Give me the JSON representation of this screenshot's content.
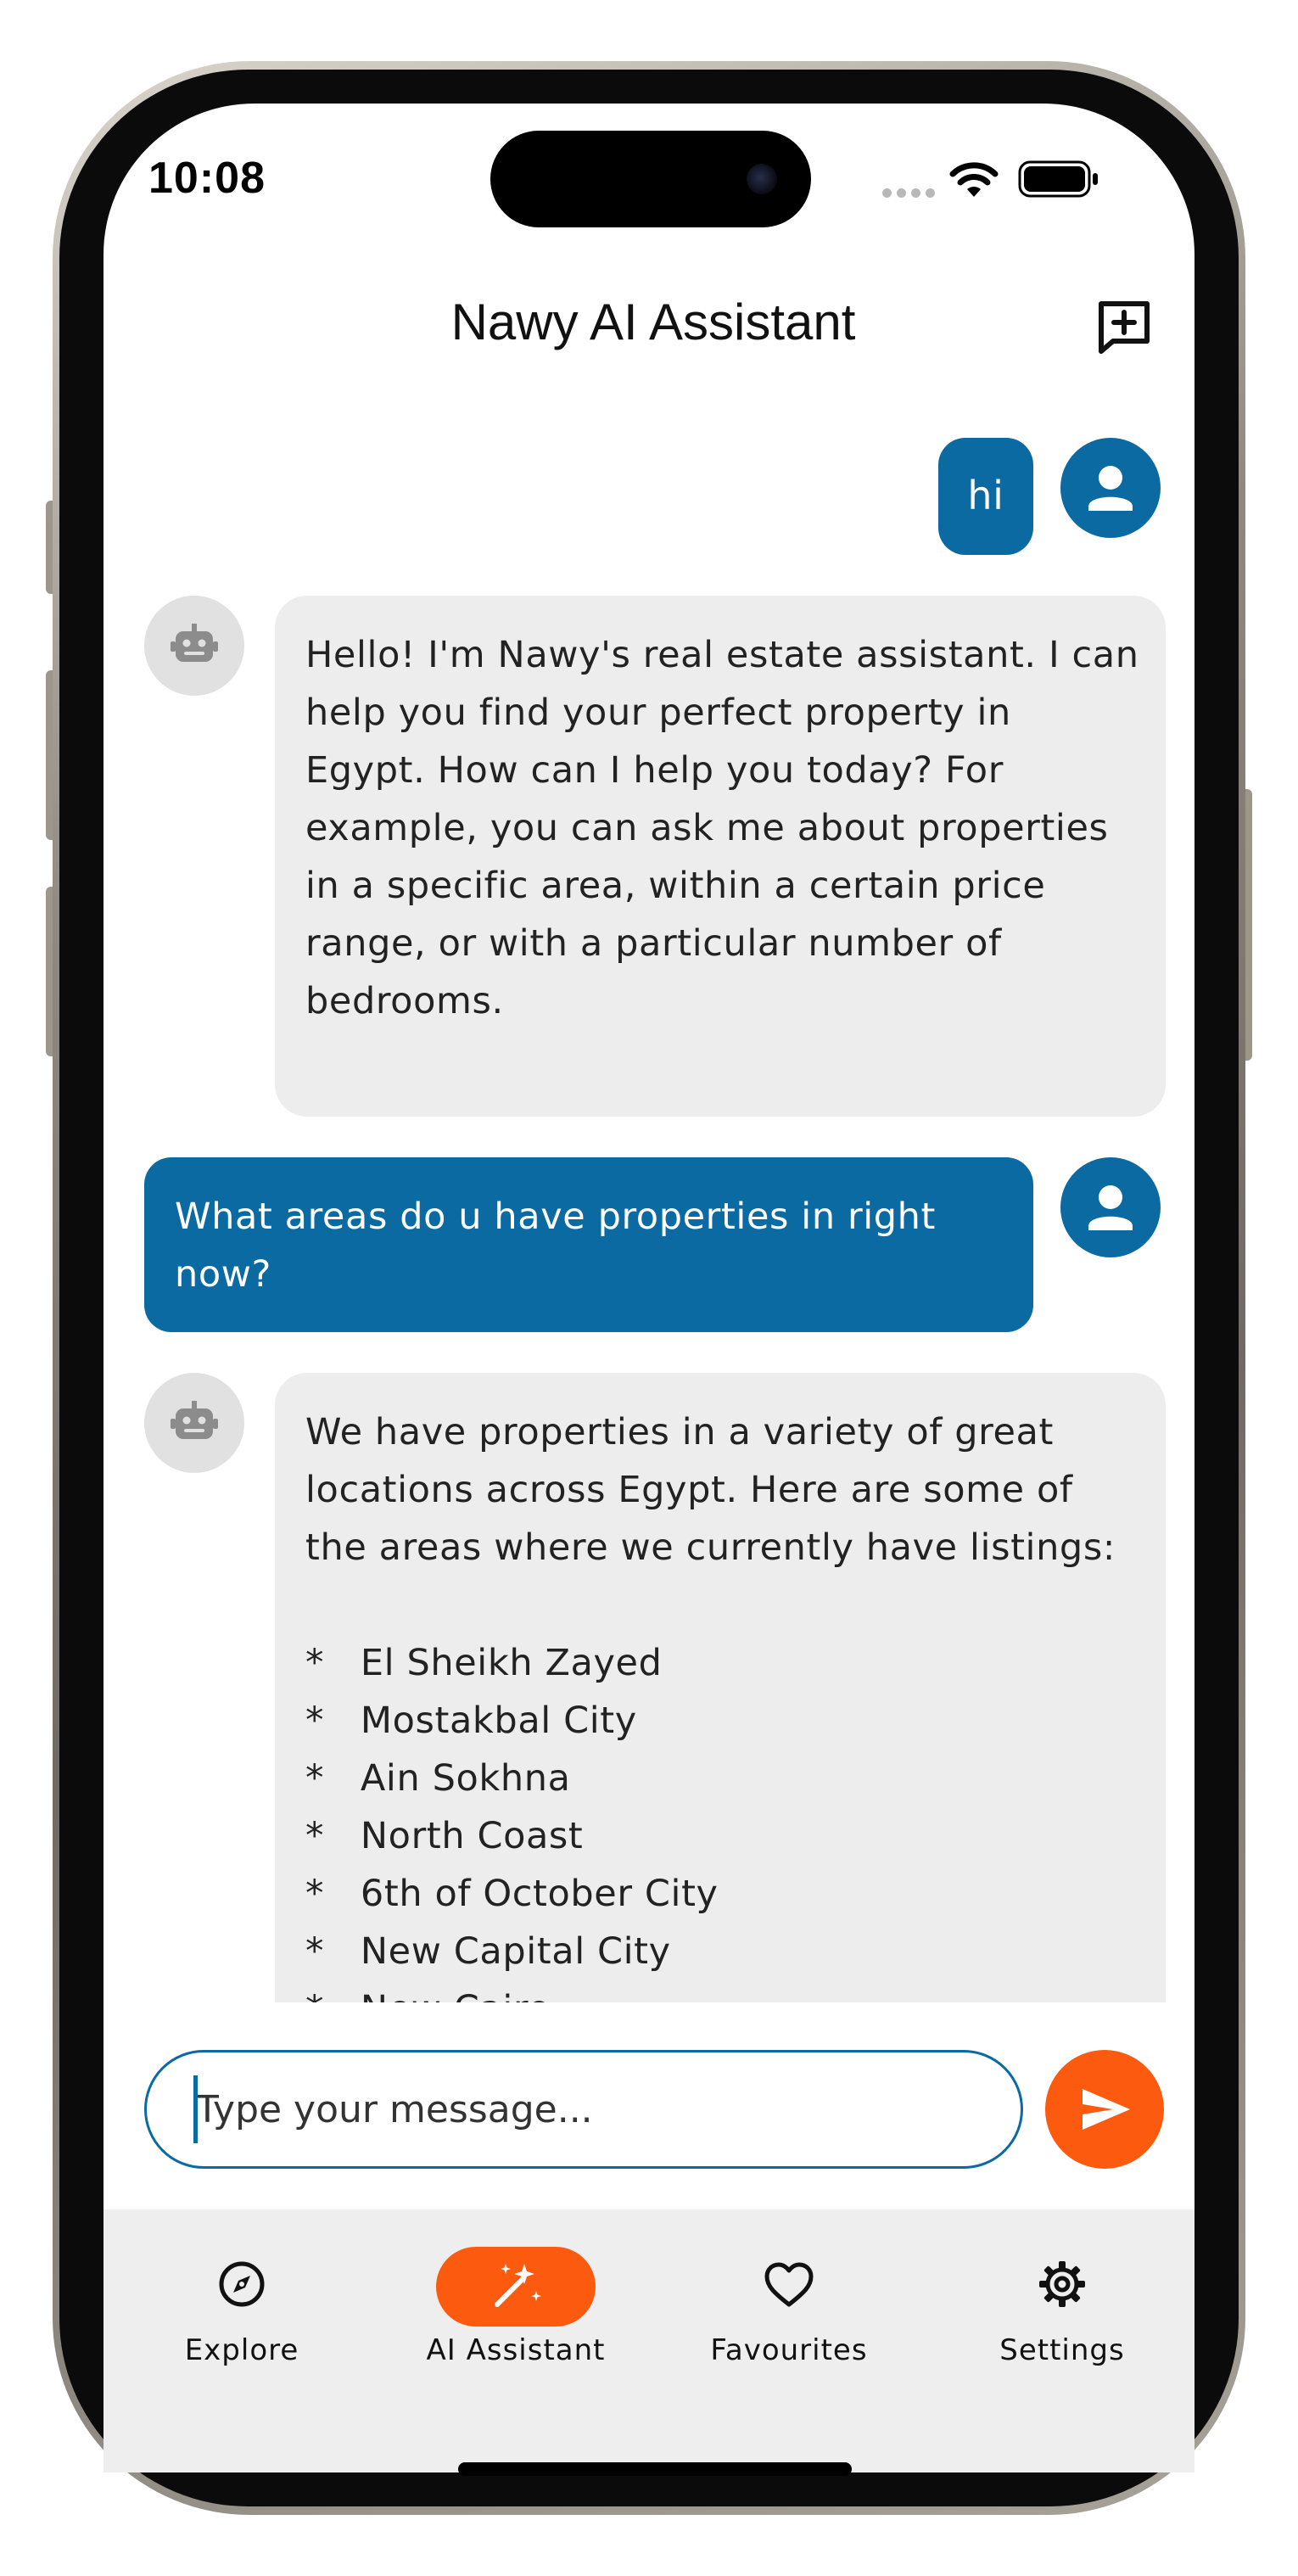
{
  "status_bar": {
    "time": "10:08"
  },
  "header": {
    "title": "Nawy AI Assistant",
    "new_chat_icon": "add-comment-icon"
  },
  "messages": [
    {
      "role": "user",
      "text": "hi"
    },
    {
      "role": "assistant",
      "text": "Hello! I'm Nawy's real estate assistant. I can help you find your perfect property in Egypt. How can I help you today? For example, you can ask me about properties in a specific area, within a certain price range, or with a particular number of bedrooms."
    },
    {
      "role": "user",
      "text": "What areas do u have properties in right now?"
    },
    {
      "role": "assistant",
      "text": "We have properties in a variety of great locations across Egypt. Here are some of the areas where we currently have listings:\n\n*   El Sheikh Zayed\n*   Mostakbal City\n*   Ain Sokhna\n*   North Coast\n*   6th of October City\n*   New Capital City\n*   New Cairo"
    }
  ],
  "composer": {
    "placeholder": "Type your message...",
    "value": "",
    "send_icon": "send-icon"
  },
  "nav": {
    "items": [
      {
        "label": "Explore",
        "icon": "compass-icon",
        "active": false
      },
      {
        "label": "AI Assistant",
        "icon": "magic-wand-icon",
        "active": true
      },
      {
        "label": "Favourites",
        "icon": "heart-icon",
        "active": false
      },
      {
        "label": "Settings",
        "icon": "gear-icon",
        "active": false
      }
    ]
  },
  "colors": {
    "primary": "#0a6aa1",
    "accent": "#fb5a0f",
    "bot_bubble": "#ededed",
    "nav_bg": "#eeeeee"
  }
}
